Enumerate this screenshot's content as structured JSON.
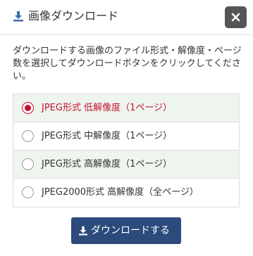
{
  "header": {
    "title": "画像ダウンロード",
    "title_icon": "download-icon",
    "close_icon": "close-icon"
  },
  "description": "ダウンロードする画像のファイル形式・解像度・ページ数を選択してダウンロードボタンをクリックしてください。",
  "options": [
    {
      "label": "JPEG形式 低解像度（1ページ）",
      "selected": true
    },
    {
      "label": "JPEG形式 中解像度（1ページ）",
      "selected": false
    },
    {
      "label": "JPEG形式 高解像度（1ページ）",
      "selected": false
    },
    {
      "label": "JPEG2000形式 高解像度（全ページ）",
      "selected": false
    }
  ],
  "download_button": {
    "label": "ダウンロードする",
    "icon": "download-icon"
  },
  "colors": {
    "accent_selected": "#c8102e",
    "button_bg": "#2c4a7c",
    "close_bg": "#555555",
    "title_icon": "#3a6ea5",
    "shaded_row": "#eef5ee"
  }
}
